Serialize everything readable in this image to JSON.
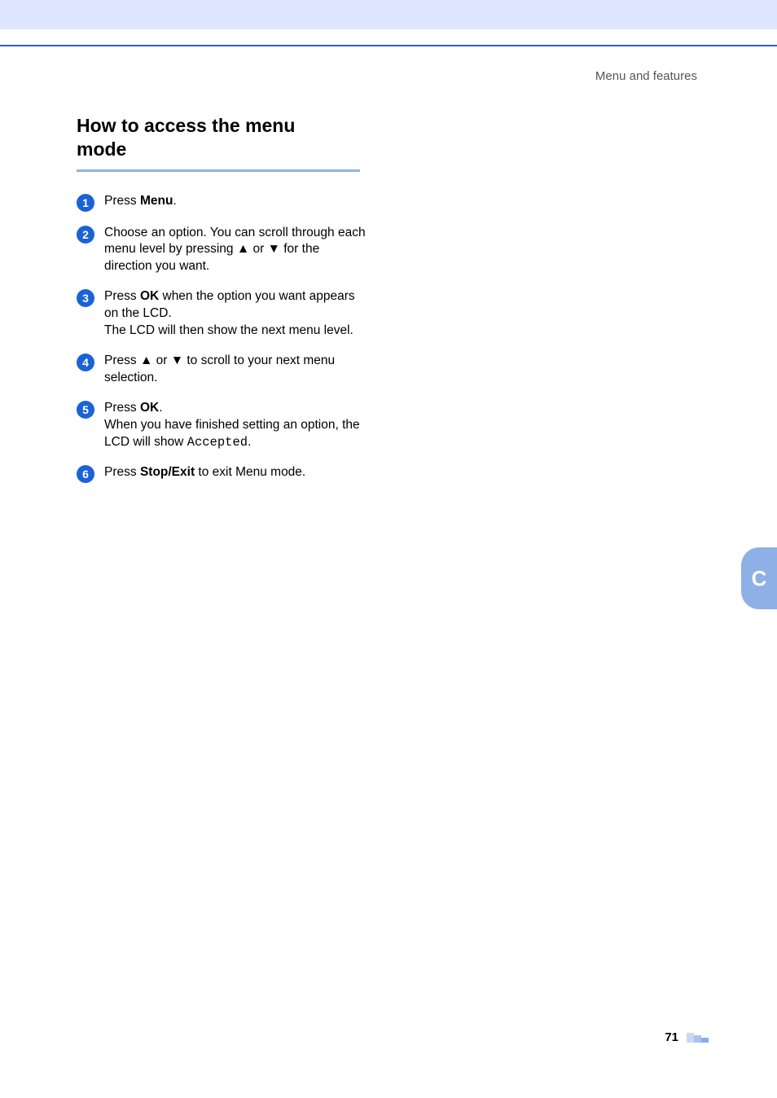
{
  "header": {
    "right_text": "Menu and features"
  },
  "heading": {
    "line1": "How to access the menu",
    "line2": "mode"
  },
  "arrows": {
    "up": "▲",
    "down": "▼"
  },
  "steps": [
    {
      "num": "1",
      "pre": "Press ",
      "bold": "Menu",
      "post": "."
    },
    {
      "num": "2",
      "text_pre": "Choose an option. You can scroll through each menu level by pressing ",
      "up": "▲",
      "mid": " or ",
      "down": "▼",
      "text_post": " for the direction you want."
    },
    {
      "num": "3",
      "pre": "Press ",
      "bold": "OK",
      "post": " when the option you want appears on the LCD.",
      "extra": "The LCD will then show the next menu level."
    },
    {
      "num": "4",
      "pre": "Press ",
      "up": "▲",
      "mid": " or ",
      "down": "▼",
      "post": " to scroll to your next menu selection."
    },
    {
      "num": "5",
      "pre": "Press ",
      "bold": "OK",
      "post": ".",
      "extra_pre": "When you have finished setting an option, the LCD will show ",
      "mono": "Accepted",
      "extra_post": "."
    },
    {
      "num": "6",
      "pre": "Press ",
      "bold": "Stop/Exit",
      "post": " to exit Menu mode."
    }
  ],
  "section_tab": "C",
  "page_number": "71"
}
